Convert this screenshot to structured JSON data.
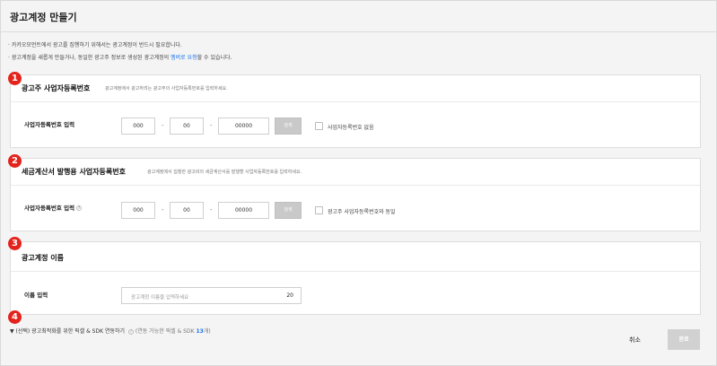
{
  "page": {
    "title": "광고계정 만들기"
  },
  "notices": [
    "카카오모먼트에서 광고를 집행하기 위해서는 광고계정이 반드시 필요합니다.",
    {
      "before": "광고계정을 새롭게 만들거나, 동일한 광고주 정보로 생성된 광고계정의 ",
      "link": "멤버로 요청",
      "after": "할 수 있습니다."
    }
  ],
  "badges": [
    "1",
    "2",
    "3",
    "4"
  ],
  "section1": {
    "title": "광고주 사업자등록번호",
    "desc": "광고계정에서 광고하려는 광고주의 사업자등록번호를 입력하세요.",
    "field_label": "사업자등록번호 입력",
    "part1": "000",
    "part2": "00",
    "part3": "00000",
    "search_label": "검색",
    "checkbox_label": "사업자등록번호 없음"
  },
  "section2": {
    "title": "세금계산서 발행용 사업자등록번호",
    "desc": "광고계정에서 집행한 광고비의 세금계산서를 발행할 사업자등록번호를 입력하세요.",
    "field_label": "사업자등록번호 입력",
    "part1": "000",
    "part2": "00",
    "part3": "00000",
    "search_label": "검색",
    "checkbox_label": "광고주 사업자등록번호와 동일"
  },
  "section3": {
    "title": "광고계정 이름",
    "field_label": "이름 입력",
    "placeholder": "광고계정 이름을 입력하세요",
    "char_count": "20"
  },
  "sdk": {
    "label": "(선택) 광고최적화를 위한 픽셀 & SDK 연동하기",
    "hint_before": "(연동 가능한 픽셀 & SDK ",
    "count": "13",
    "hint_after": "개)"
  },
  "footer": {
    "cancel": "취소",
    "submit": "완료"
  },
  "colors": {
    "accent_link": "#1a73e8",
    "badge": "#e3231c",
    "disabled_button": "#c9c9c9"
  },
  "icons": {
    "info": "info-circle-icon",
    "toggle": "triangle-down-icon"
  }
}
